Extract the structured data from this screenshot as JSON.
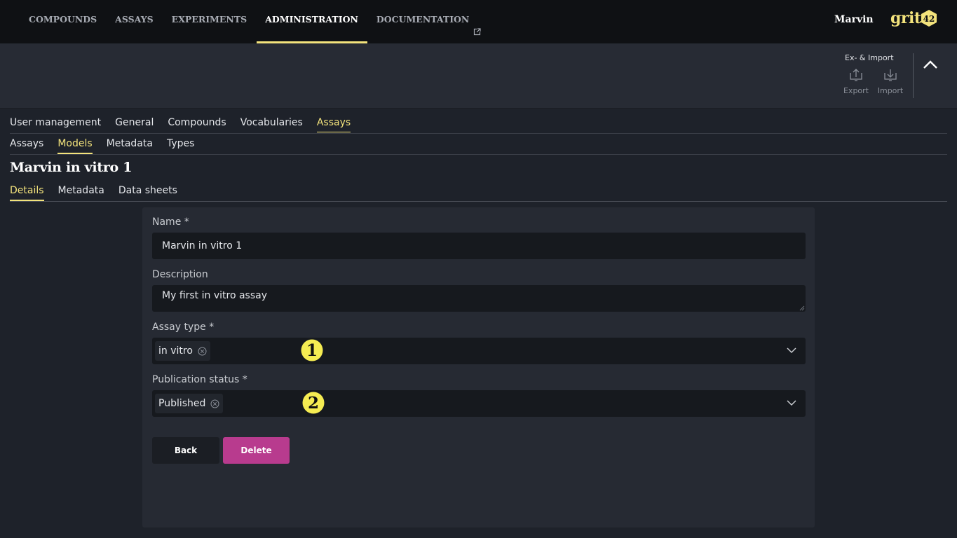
{
  "nav": {
    "items": [
      "COMPOUNDS",
      "ASSAYS",
      "EXPERIMENTS",
      "ADMINISTRATION",
      "DOCUMENTATION"
    ],
    "active": "ADMINISTRATION",
    "user": "Marvin",
    "logo_text": "grit",
    "logo_number": "42"
  },
  "toolbar": {
    "group_title": "Ex- & Import",
    "export_label": "Export",
    "import_label": "Import"
  },
  "admin_tabs": [
    "User management",
    "General",
    "Compounds",
    "Vocabularies",
    "Assays"
  ],
  "admin_tabs_active": "Assays",
  "assay_tabs": [
    "Assays",
    "Models",
    "Metadata",
    "Types"
  ],
  "assay_tabs_active": "Models",
  "page_title": "Marvin in vitro 1",
  "detail_tabs": [
    "Details",
    "Metadata",
    "Data sheets"
  ],
  "detail_tabs_active": "Details",
  "form": {
    "name_label": "Name *",
    "name_value": "Marvin in vitro 1",
    "description_label": "Description",
    "description_value": "My first in vitro assay",
    "assay_type_label": "Assay type *",
    "assay_type_value": "in vitro",
    "publication_status_label": "Publication status *",
    "publication_status_value": "Published",
    "back_label": "Back",
    "delete_label": "Delete"
  },
  "annotations": [
    "1",
    "2"
  ],
  "colors": {
    "accent": "#f3e37c",
    "delete": "#b83b8e",
    "nav_bg": "#0f1114",
    "page_bg": "#1e222a",
    "card_bg": "#262a33",
    "input_bg": "#16191e"
  }
}
